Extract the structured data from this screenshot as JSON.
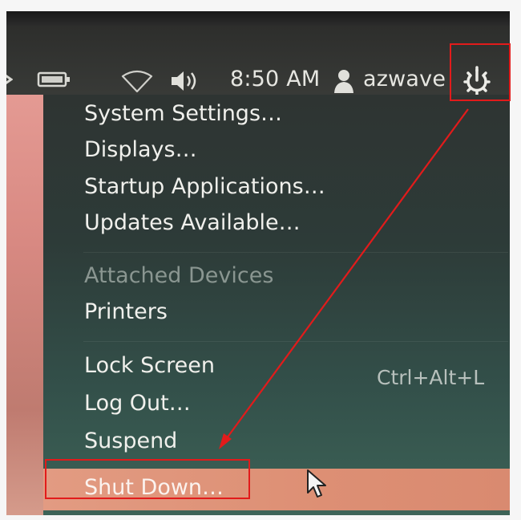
{
  "topbar": {
    "time": "8:50 AM",
    "username": "azwave",
    "icons": [
      "battery-icon",
      "wifi-icon",
      "volume-icon",
      "user-icon",
      "power-gear-icon"
    ]
  },
  "menu": {
    "items": [
      {
        "label": "System Settings…",
        "enabled": true
      },
      {
        "label": "Displays…",
        "enabled": true
      },
      {
        "label": "Startup Applications…",
        "enabled": true
      },
      {
        "label": "Updates Available…",
        "enabled": true
      },
      {
        "label": "Attached Devices",
        "enabled": false
      },
      {
        "label": "Printers",
        "enabled": true
      },
      {
        "label": "Lock Screen",
        "enabled": true,
        "shortcut": "Ctrl+Alt+L"
      },
      {
        "label": "Log Out…",
        "enabled": true
      },
      {
        "label": "Suspend",
        "enabled": true
      },
      {
        "label": "Shut Down…",
        "enabled": true,
        "highlighted": true
      }
    ]
  },
  "colors": {
    "annotation": "#e21b1b",
    "highlight": "#dd8f74",
    "menu_bg": "#2e3432"
  }
}
